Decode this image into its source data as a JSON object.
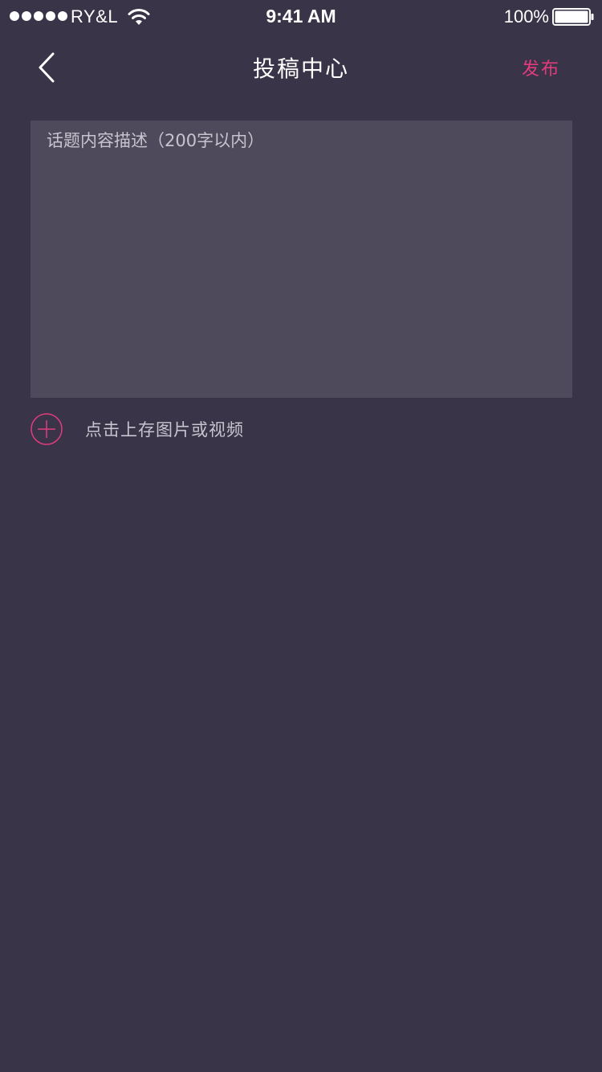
{
  "status_bar": {
    "carrier": "RY&L",
    "time": "9:41 AM",
    "battery": "100%",
    "icons": {
      "signal": "signal-dots-icon",
      "wifi": "wifi-icon",
      "battery": "battery-icon"
    }
  },
  "nav": {
    "back_icon": "chevron-left-icon",
    "title": "投稿中心",
    "publish_label": "发布"
  },
  "form": {
    "description": {
      "placeholder": "话题内容描述（200字以内）",
      "value": ""
    },
    "upload": {
      "icon": "plus-circle-icon",
      "label": "点击上存图片或视频"
    }
  },
  "colors": {
    "background": "#393447",
    "input_background": "#4e4a5b",
    "accent": "#e23c7d",
    "text_primary": "#ffffff",
    "text_secondary": "#c8c4cf"
  }
}
